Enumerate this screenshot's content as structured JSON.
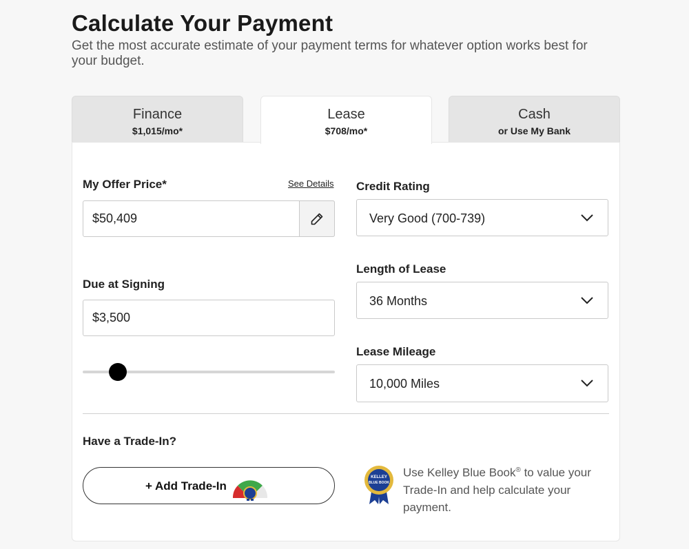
{
  "header": {
    "title": "Calculate Your Payment",
    "subtitle": "Get the most accurate estimate of your payment terms for whatever option works best for your budget."
  },
  "tabs": [
    {
      "label": "Finance",
      "sub": "$1,015/mo*",
      "active": false
    },
    {
      "label": "Lease",
      "sub": "$708/mo*",
      "active": true
    },
    {
      "label": "Cash",
      "sub": "or Use My Bank",
      "active": false
    }
  ],
  "offer": {
    "label": "My Offer Price*",
    "details_link": "See Details",
    "value": "$50,409",
    "edit_icon": "pencil-icon"
  },
  "due": {
    "label": "Due at Signing",
    "value": "$3,500",
    "slider_fraction": 0.14
  },
  "credit": {
    "label": "Credit Rating",
    "value": "Very Good (700-739)"
  },
  "length": {
    "label": "Length of Lease",
    "value": "36 Months"
  },
  "mileage": {
    "label": "Lease Mileage",
    "value": "10,000 Miles"
  },
  "trade": {
    "label": "Have a Trade-In?",
    "button": "+ Add Trade-In",
    "kbb_text_before": "Use Kelley Blue Book",
    "kbb_reg": "®",
    "kbb_text_after": " to value your Trade-In and help calculate your payment.",
    "kbb_logo_text": "KELLEY BLUE BOOK"
  },
  "colors": {
    "accent": "#000000",
    "tab_inactive": "#e5e5e5",
    "kbb_blue": "#1c3f94",
    "kbb_gold": "#e3b93d"
  }
}
